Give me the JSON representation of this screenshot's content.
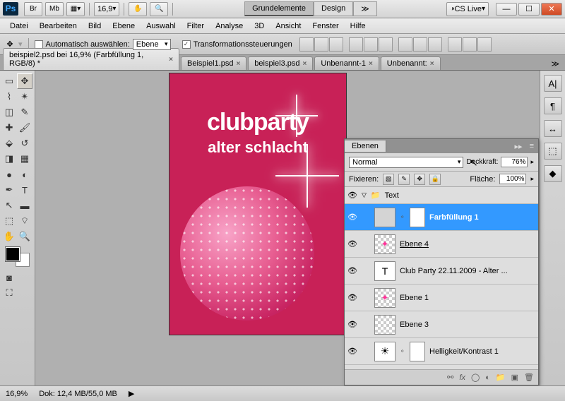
{
  "titlebar": {
    "zoom_pct": "16,9",
    "workspace_active": "Grundelemente",
    "workspace_other": "Design",
    "cslive": "CS Live"
  },
  "menu": [
    "Datei",
    "Bearbeiten",
    "Bild",
    "Ebene",
    "Auswahl",
    "Filter",
    "Analyse",
    "3D",
    "Ansicht",
    "Fenster",
    "Hilfe"
  ],
  "options": {
    "auto_select": "Automatisch auswählen:",
    "auto_select_mode": "Ebene",
    "transform_controls": "Transformationssteuerungen"
  },
  "tabs": [
    {
      "label": "beispiel2.psd bei 16,9% (Farbfüllung 1, RGB/8) *",
      "active": true
    },
    {
      "label": "Beispiel1.psd",
      "active": false
    },
    {
      "label": "beispiel3.psd",
      "active": false
    },
    {
      "label": "Unbenannt-1",
      "active": false
    },
    {
      "label": "Unbenannt:",
      "active": false
    }
  ],
  "canvas": {
    "headline": "clubparty",
    "subline": "alter schlacht"
  },
  "panel": {
    "title": "Ebenen",
    "blend": "Normal",
    "opacity_label": "Deckkraft:",
    "opacity": "76%",
    "lock_label": "Fixieren:",
    "fill_label": "Fläche:",
    "fill": "100%",
    "group": "Text",
    "layers": [
      {
        "name": "Farbfüllung 1",
        "sel": true,
        "mask": true,
        "thumb": "fill"
      },
      {
        "name": "Ebene 4",
        "sel": false,
        "thumb": "sparkle",
        "underline": true
      },
      {
        "name": "Club Party 22.11.2009 -   Alter   ...",
        "sel": false,
        "thumb": "T"
      },
      {
        "name": "Ebene 1",
        "sel": false,
        "thumb": "sparkle2"
      },
      {
        "name": "Ebene 3",
        "sel": false,
        "thumb": "checker"
      },
      {
        "name": "Helligkeit/Kontrast 1",
        "sel": false,
        "thumb": "adj",
        "mask": true
      }
    ]
  },
  "status": {
    "zoom": "16,9%",
    "doc": "Dok: 12,4 MB/55,0 MB"
  },
  "rail_icons": [
    "A|",
    "¶",
    "↔",
    "⬚",
    "◆"
  ]
}
